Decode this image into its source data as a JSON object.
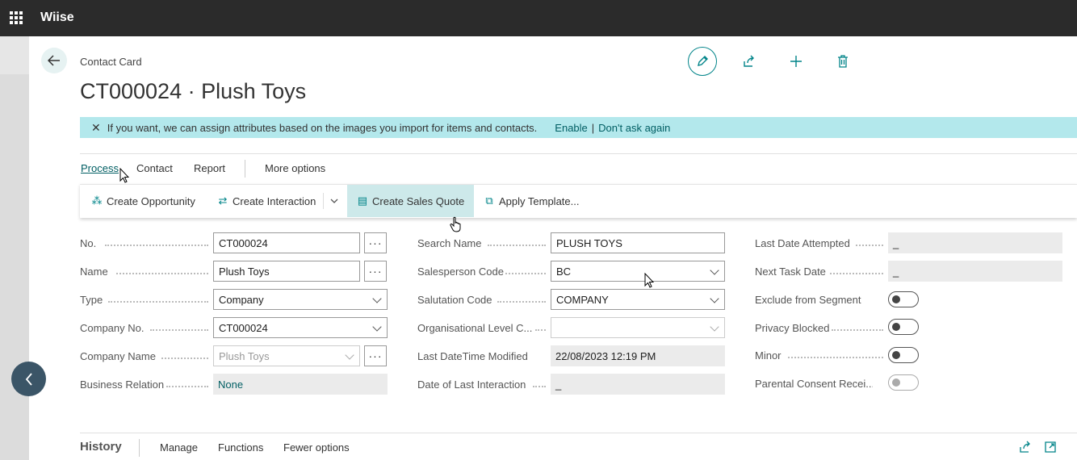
{
  "app": {
    "brand": "Wiise"
  },
  "header": {
    "breadcrumb": "Contact Card",
    "title": "CT000024 · Plush Toys"
  },
  "banner": {
    "message": "If you want, we can assign attributes based on the images you import for items and contacts.",
    "enable": "Enable",
    "separator": "|",
    "dont_ask": "Don't ask again"
  },
  "actions": {
    "process": "Process",
    "contact": "Contact",
    "report": "Report",
    "more": "More options"
  },
  "ribbon": {
    "create_opportunity": "Create Opportunity",
    "create_interaction": "Create Interaction",
    "create_sales_quote": "Create Sales Quote",
    "apply_template": "Apply Template..."
  },
  "fields": {
    "no": {
      "label": "No.",
      "value": "CT000024"
    },
    "name": {
      "label": "Name",
      "value": "Plush Toys"
    },
    "type": {
      "label": "Type",
      "value": "Company"
    },
    "company_no": {
      "label": "Company No.",
      "value": "CT000024"
    },
    "company_name": {
      "label": "Company Name",
      "value": "Plush Toys"
    },
    "business_relation": {
      "label": "Business Relation",
      "value": "None"
    },
    "search_name": {
      "label": "Search Name",
      "value": "PLUSH TOYS"
    },
    "salesperson_code": {
      "label": "Salesperson Code",
      "value": "BC"
    },
    "salutation_code": {
      "label": "Salutation Code",
      "value": "COMPANY"
    },
    "org_level": {
      "label": "Organisational Level C...",
      "value": ""
    },
    "last_modified": {
      "label": "Last DateTime Modified",
      "value": "22/08/2023 12:19 PM"
    },
    "last_interaction": {
      "label": "Date of Last Interaction",
      "value": "_"
    },
    "last_attempted": {
      "label": "Last Date Attempted",
      "value": "_"
    },
    "next_task": {
      "label": "Next Task Date",
      "value": "_"
    },
    "exclude_segment": {
      "label": "Exclude from Segment",
      "value": false
    },
    "privacy_blocked": {
      "label": "Privacy Blocked",
      "value": false
    },
    "minor": {
      "label": "Minor",
      "value": false
    },
    "parental_consent": {
      "label": "Parental Consent Recei...",
      "value": false
    }
  },
  "history": {
    "title": "History",
    "manage": "Manage",
    "functions": "Functions",
    "fewer": "Fewer options"
  },
  "colors": {
    "accent": "#008489",
    "banner": "#b3e8ec",
    "topbar": "#2b2b2b"
  }
}
